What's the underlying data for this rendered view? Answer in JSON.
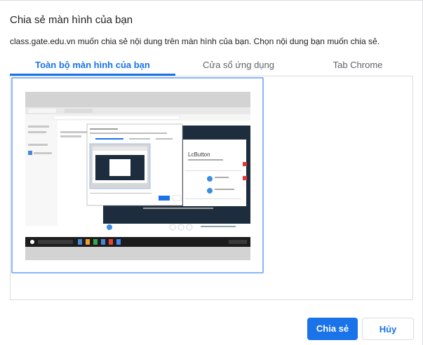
{
  "dialog": {
    "title": "Chia sẻ màn hình của bạn",
    "description": "class.gate.edu.vn muốn chia sẻ nội dung trên màn hình của bạn. Chọn nội dung bạn muốn chia sẻ."
  },
  "tabs": [
    {
      "label": "Toàn bộ màn hình của bạn",
      "active": true
    },
    {
      "label": "Cửa sổ ứng dụng",
      "active": false
    },
    {
      "label": "Tab Chrome",
      "active": false
    }
  ],
  "colors": {
    "accent": "#1a73e8",
    "selection_border": "#8ab4f8"
  },
  "buttons": {
    "share_label": "Chia sẻ",
    "cancel_label": "Hủy"
  }
}
